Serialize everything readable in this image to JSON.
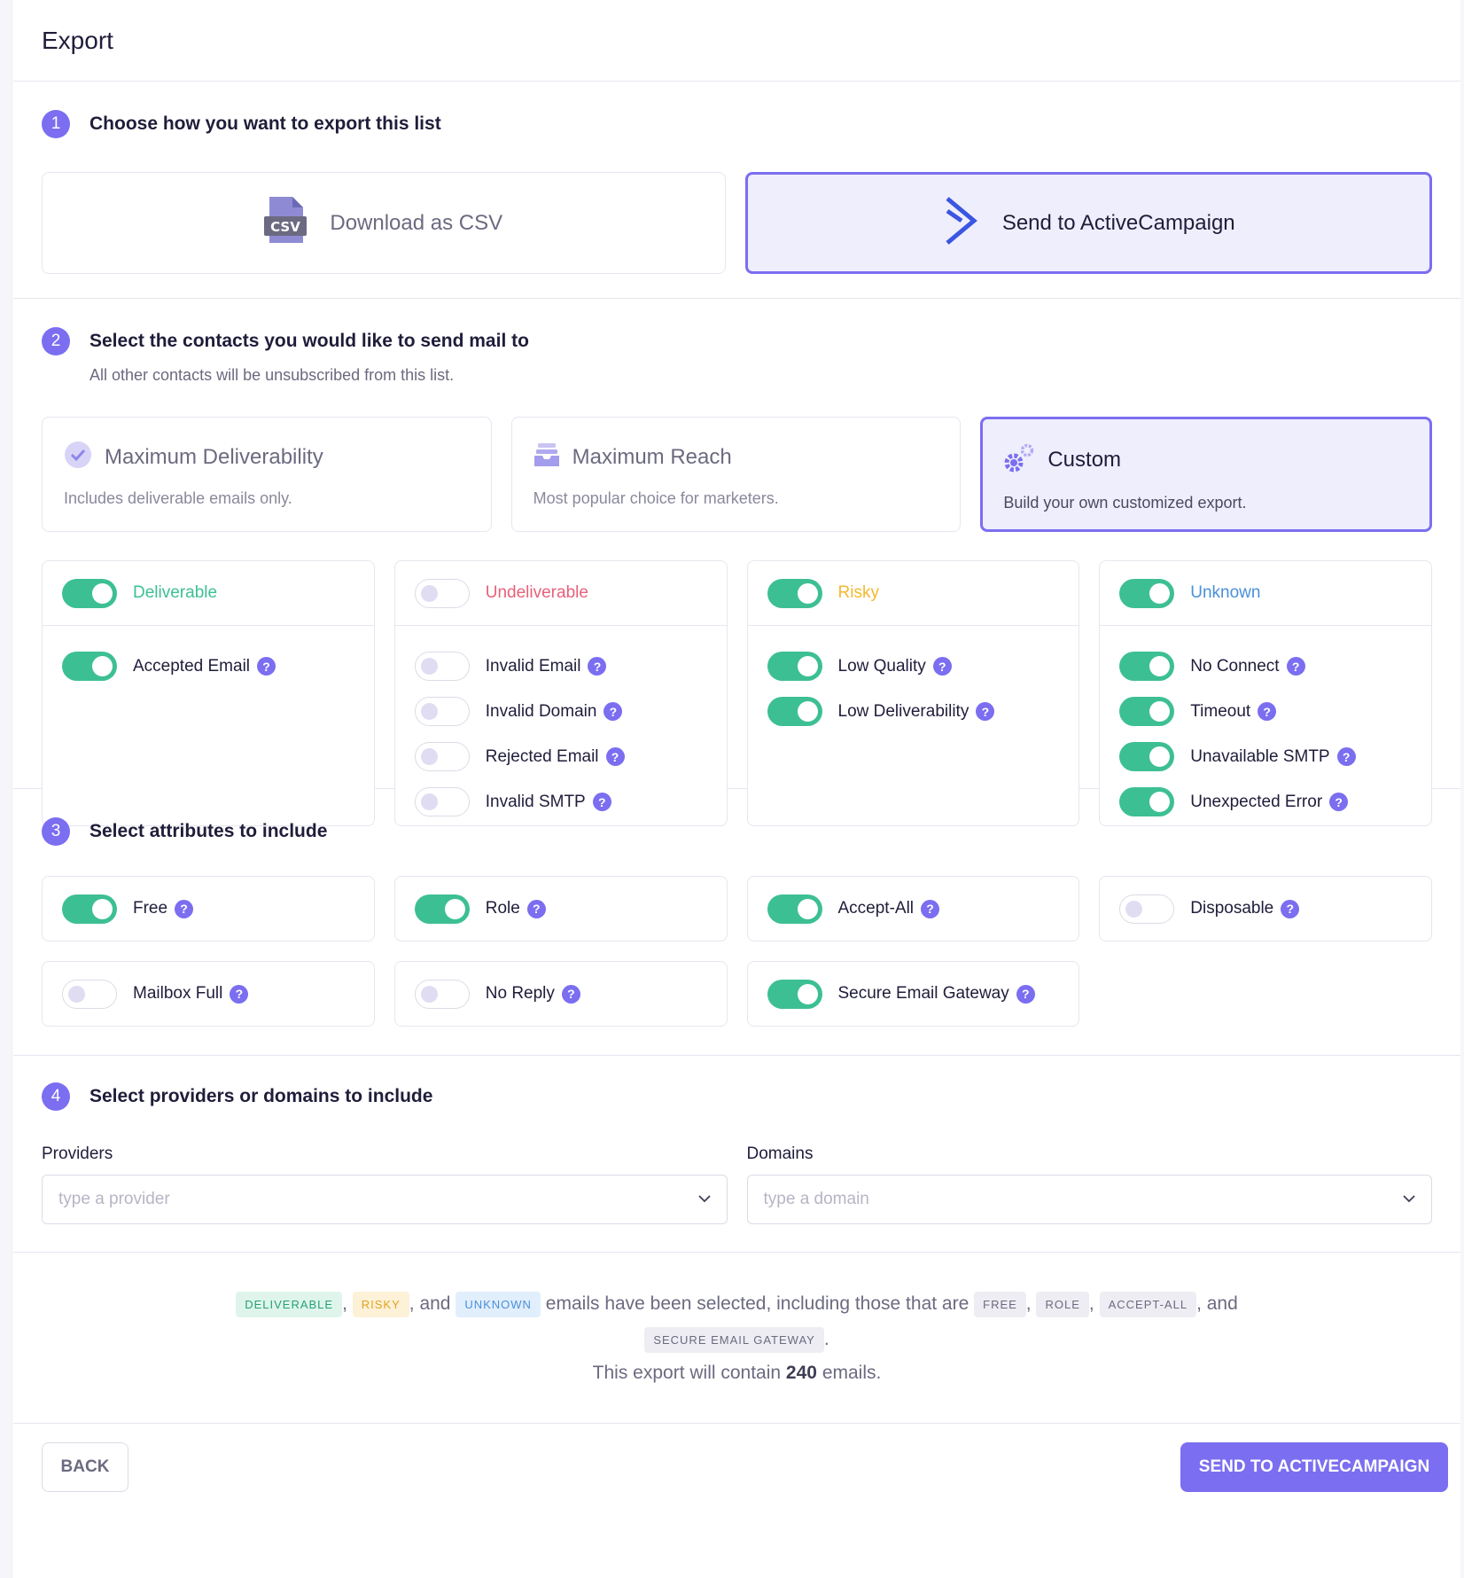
{
  "header": {
    "title": "Export"
  },
  "step1": {
    "num": "1",
    "title": "Choose how you want to export this list",
    "options": [
      {
        "label": "Download as CSV",
        "icon": "csv-file-icon",
        "selected": false
      },
      {
        "label": "Send to ActiveCampaign",
        "icon": "activecampaign-logo-icon",
        "selected": true
      }
    ],
    "csv_icon_text": "CSV"
  },
  "step2": {
    "num": "2",
    "title": "Select the contacts you would like to send mail to",
    "subtitle": "All other contacts will be unsubscribed from this list.",
    "presets": [
      {
        "title": "Maximum Deliverability",
        "desc": "Includes deliverable emails only.",
        "icon": "check-circle-icon",
        "selected": false
      },
      {
        "title": "Maximum Reach",
        "desc": "Most popular choice for marketers.",
        "icon": "inbox-icon",
        "selected": false
      },
      {
        "title": "Custom",
        "desc": "Build your own customized export.",
        "icon": "gears-icon",
        "selected": true
      }
    ],
    "categories": [
      {
        "name": "Deliverable",
        "color": "#3dbf94",
        "on": true,
        "items": [
          {
            "name": "Accepted Email",
            "on": true
          }
        ]
      },
      {
        "name": "Undeliverable",
        "color": "#e8617a",
        "on": false,
        "items": [
          {
            "name": "Invalid Email",
            "on": false
          },
          {
            "name": "Invalid Domain",
            "on": false
          },
          {
            "name": "Rejected Email",
            "on": false
          },
          {
            "name": "Invalid SMTP",
            "on": false
          }
        ]
      },
      {
        "name": "Risky",
        "color": "#f5b92e",
        "on": true,
        "items": [
          {
            "name": "Low Quality",
            "on": true
          },
          {
            "name": "Low Deliverability",
            "on": true
          }
        ]
      },
      {
        "name": "Unknown",
        "color": "#4a90d9",
        "on": true,
        "items": [
          {
            "name": "No Connect",
            "on": true
          },
          {
            "name": "Timeout",
            "on": true
          },
          {
            "name": "Unavailable SMTP",
            "on": true
          },
          {
            "name": "Unexpected Error",
            "on": true
          }
        ]
      }
    ]
  },
  "step3": {
    "num": "3",
    "title": "Select attributes to include",
    "attributes": [
      {
        "name": "Free",
        "on": true
      },
      {
        "name": "Role",
        "on": true
      },
      {
        "name": "Accept-All",
        "on": true
      },
      {
        "name": "Disposable",
        "on": false
      },
      {
        "name": "Mailbox Full",
        "on": false
      },
      {
        "name": "No Reply",
        "on": false
      },
      {
        "name": "Secure Email Gateway",
        "on": true
      }
    ]
  },
  "step4": {
    "num": "4",
    "title": "Select providers or domains to include",
    "providers": {
      "label": "Providers",
      "placeholder": "type a provider"
    },
    "domains": {
      "label": "Domains",
      "placeholder": "type a domain"
    }
  },
  "summary": {
    "tag_deliverable": "DELIVERABLE",
    "tag_risky": "RISKY",
    "tag_unknown": "UNKNOWN",
    "tag_free": "FREE",
    "tag_role": "ROLE",
    "tag_accept_all": "ACCEPT-ALL",
    "tag_seg": "SECURE EMAIL GATEWAY",
    "sep_comma": ",",
    "sep_and": ", and",
    "text_selected": "emails have been selected, including those that are",
    "text_end": ".",
    "total_prefix": "This export will contain",
    "total_count": "240",
    "total_suffix": "emails."
  },
  "footer": {
    "back_label": "BACK",
    "send_label": "SEND TO ACTIVECAMPAIGN"
  },
  "help_glyph": "?"
}
